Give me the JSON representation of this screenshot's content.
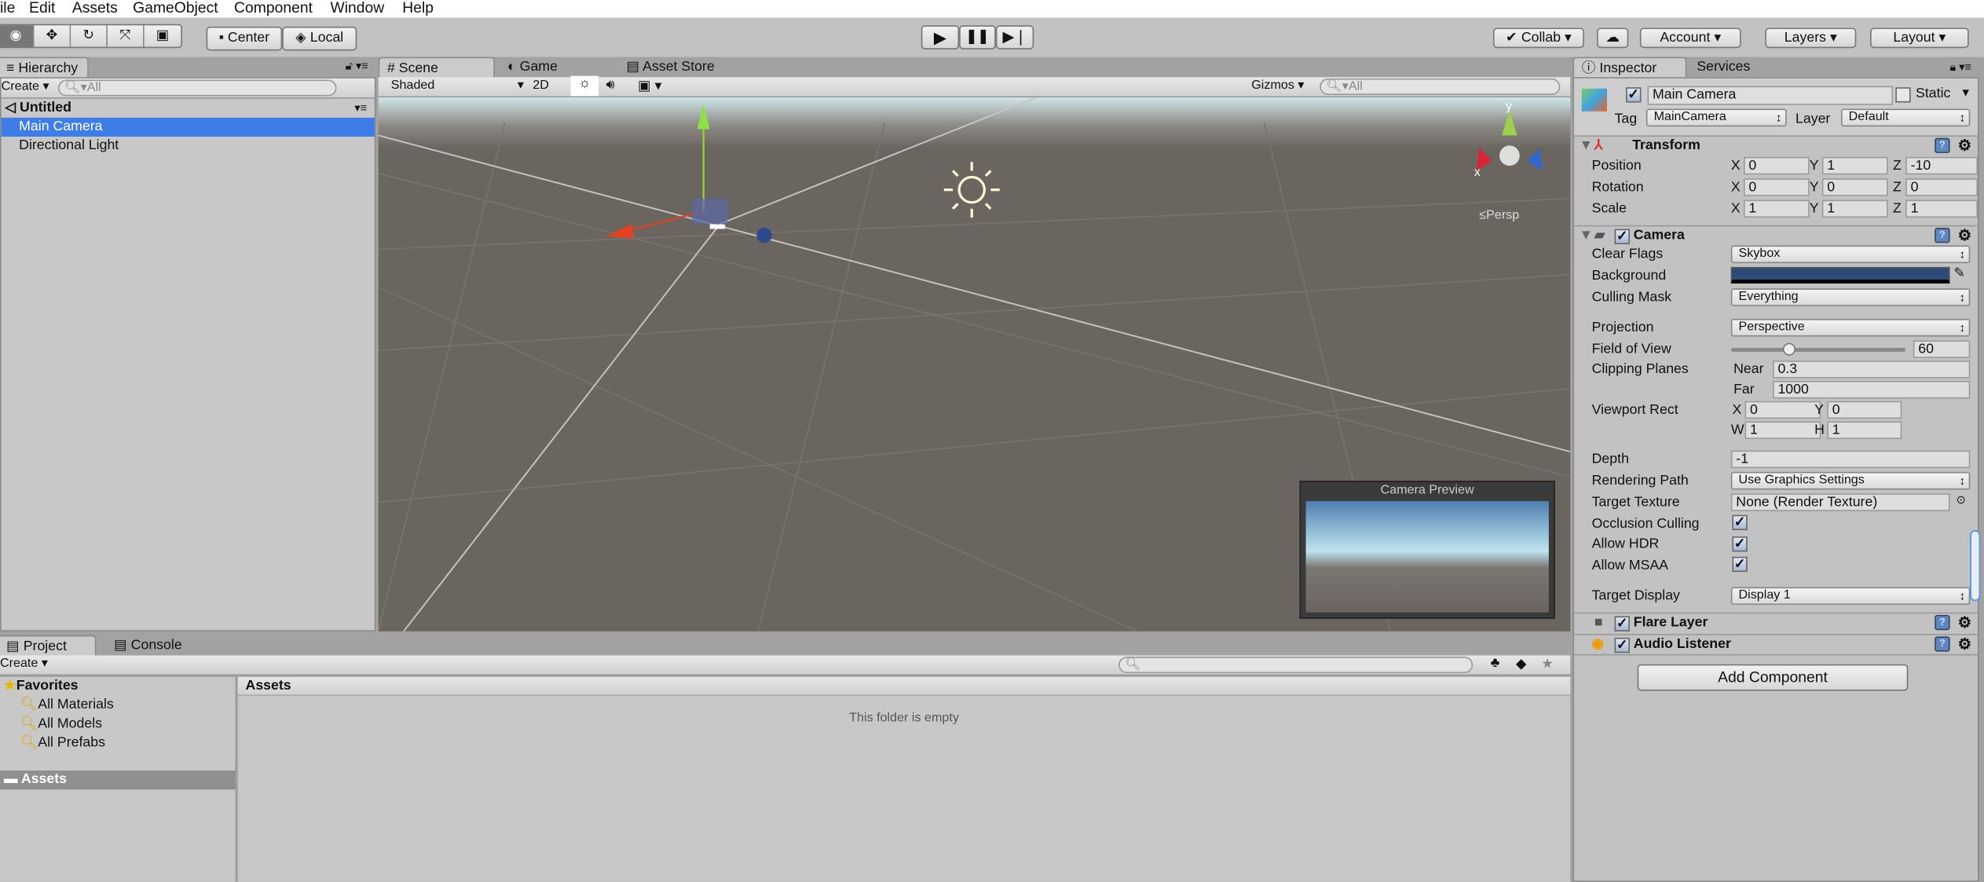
{
  "menu": [
    "ile",
    "Edit",
    "Assets",
    "GameObject",
    "Component",
    "Window",
    "Help"
  ],
  "toolbar": {
    "pivot": "Center",
    "space": "Local",
    "play_icon": "play-icon",
    "pause_icon": "pause-icon",
    "step_icon": "step-icon",
    "collab": "Collab",
    "account": "Account",
    "layers": "Layers",
    "layout": "Layout"
  },
  "hierarchy": {
    "tab": "Hierarchy",
    "create": "Create",
    "search": "All",
    "scene": "Untitled",
    "items": [
      "Main Camera",
      "Directional Light"
    ],
    "selected": "Main Camera"
  },
  "scene": {
    "tabs": [
      "Scene",
      "Game",
      "Asset Store"
    ],
    "shading": "Shaded",
    "mode2d": "2D",
    "gizmos": "Gizmos",
    "search": "All",
    "persp": "Persp",
    "axis_x": "x",
    "axis_y": "y",
    "preview_title": "Camera Preview"
  },
  "project": {
    "tabs": [
      "Project",
      "Console"
    ],
    "create": "Create",
    "favorites": "Favorites",
    "fav_items": [
      "All Materials",
      "All Models",
      "All Prefabs"
    ],
    "assets": "Assets",
    "assets_header": "Assets",
    "empty": "This folder is empty"
  },
  "inspector": {
    "tabs": [
      "Inspector",
      "Services"
    ],
    "name": "Main Camera",
    "active": true,
    "static_label": "Static",
    "static": false,
    "tag_label": "Tag",
    "tag": "MainCamera",
    "layer_label": "Layer",
    "layer": "Default",
    "transform": {
      "title": "Transform",
      "rows": [
        {
          "label": "Position",
          "x": "0",
          "y": "1",
          "z": "-10"
        },
        {
          "label": "Rotation",
          "x": "0",
          "y": "0",
          "z": "0"
        },
        {
          "label": "Scale",
          "x": "1",
          "y": "1",
          "z": "1"
        }
      ]
    },
    "camera": {
      "title": "Camera",
      "clear_flags_label": "Clear Flags",
      "clear_flags": "Skybox",
      "background_label": "Background",
      "background_color": "#2e4a78",
      "culling_mask_label": "Culling Mask",
      "culling_mask": "Everything",
      "projection_label": "Projection",
      "projection": "Perspective",
      "fov_label": "Field of View",
      "fov": "60",
      "fov_fraction": 0.33,
      "clipping_label": "Clipping Planes",
      "near_label": "Near",
      "near": "0.3",
      "far_label": "Far",
      "far": "1000",
      "viewport_label": "Viewport Rect",
      "vx": "0",
      "vy": "0",
      "vw": "1",
      "vh": "1",
      "depth_label": "Depth",
      "depth": "-1",
      "render_path_label": "Rendering Path",
      "render_path": "Use Graphics Settings",
      "target_texture_label": "Target Texture",
      "target_texture": "None (Render Texture)",
      "occlusion_label": "Occlusion Culling",
      "hdr_label": "Allow HDR",
      "msaa_label": "Allow MSAA",
      "target_display_label": "Target Display",
      "target_display": "Display 1"
    },
    "flare": "Flare Layer",
    "audio": "Audio Listener",
    "add_component": "Add Component"
  },
  "colors": {
    "selection": "#3e7de8",
    "panel": "#c2c2c2",
    "ground": "#6b6560"
  }
}
